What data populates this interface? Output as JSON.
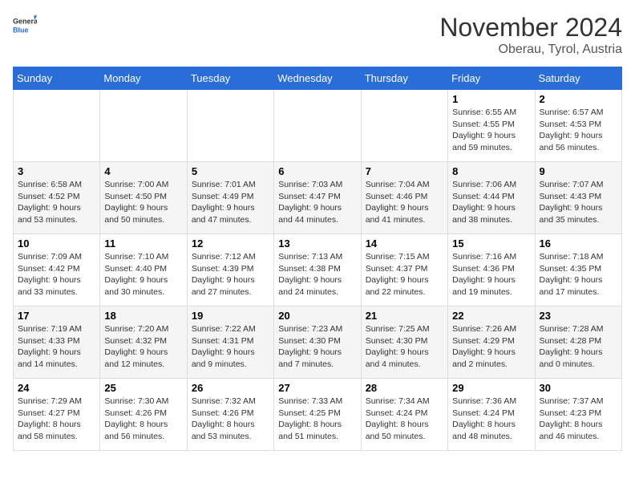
{
  "header": {
    "logo_line1": "General",
    "logo_line2": "Blue",
    "month": "November 2024",
    "location": "Oberau, Tyrol, Austria"
  },
  "days_of_week": [
    "Sunday",
    "Monday",
    "Tuesday",
    "Wednesday",
    "Thursday",
    "Friday",
    "Saturday"
  ],
  "weeks": [
    [
      {
        "day": "",
        "info": ""
      },
      {
        "day": "",
        "info": ""
      },
      {
        "day": "",
        "info": ""
      },
      {
        "day": "",
        "info": ""
      },
      {
        "day": "",
        "info": ""
      },
      {
        "day": "1",
        "info": "Sunrise: 6:55 AM\nSunset: 4:55 PM\nDaylight: 9 hours and 59 minutes."
      },
      {
        "day": "2",
        "info": "Sunrise: 6:57 AM\nSunset: 4:53 PM\nDaylight: 9 hours and 56 minutes."
      }
    ],
    [
      {
        "day": "3",
        "info": "Sunrise: 6:58 AM\nSunset: 4:52 PM\nDaylight: 9 hours and 53 minutes."
      },
      {
        "day": "4",
        "info": "Sunrise: 7:00 AM\nSunset: 4:50 PM\nDaylight: 9 hours and 50 minutes."
      },
      {
        "day": "5",
        "info": "Sunrise: 7:01 AM\nSunset: 4:49 PM\nDaylight: 9 hours and 47 minutes."
      },
      {
        "day": "6",
        "info": "Sunrise: 7:03 AM\nSunset: 4:47 PM\nDaylight: 9 hours and 44 minutes."
      },
      {
        "day": "7",
        "info": "Sunrise: 7:04 AM\nSunset: 4:46 PM\nDaylight: 9 hours and 41 minutes."
      },
      {
        "day": "8",
        "info": "Sunrise: 7:06 AM\nSunset: 4:44 PM\nDaylight: 9 hours and 38 minutes."
      },
      {
        "day": "9",
        "info": "Sunrise: 7:07 AM\nSunset: 4:43 PM\nDaylight: 9 hours and 35 minutes."
      }
    ],
    [
      {
        "day": "10",
        "info": "Sunrise: 7:09 AM\nSunset: 4:42 PM\nDaylight: 9 hours and 33 minutes."
      },
      {
        "day": "11",
        "info": "Sunrise: 7:10 AM\nSunset: 4:40 PM\nDaylight: 9 hours and 30 minutes."
      },
      {
        "day": "12",
        "info": "Sunrise: 7:12 AM\nSunset: 4:39 PM\nDaylight: 9 hours and 27 minutes."
      },
      {
        "day": "13",
        "info": "Sunrise: 7:13 AM\nSunset: 4:38 PM\nDaylight: 9 hours and 24 minutes."
      },
      {
        "day": "14",
        "info": "Sunrise: 7:15 AM\nSunset: 4:37 PM\nDaylight: 9 hours and 22 minutes."
      },
      {
        "day": "15",
        "info": "Sunrise: 7:16 AM\nSunset: 4:36 PM\nDaylight: 9 hours and 19 minutes."
      },
      {
        "day": "16",
        "info": "Sunrise: 7:18 AM\nSunset: 4:35 PM\nDaylight: 9 hours and 17 minutes."
      }
    ],
    [
      {
        "day": "17",
        "info": "Sunrise: 7:19 AM\nSunset: 4:33 PM\nDaylight: 9 hours and 14 minutes."
      },
      {
        "day": "18",
        "info": "Sunrise: 7:20 AM\nSunset: 4:32 PM\nDaylight: 9 hours and 12 minutes."
      },
      {
        "day": "19",
        "info": "Sunrise: 7:22 AM\nSunset: 4:31 PM\nDaylight: 9 hours and 9 minutes."
      },
      {
        "day": "20",
        "info": "Sunrise: 7:23 AM\nSunset: 4:30 PM\nDaylight: 9 hours and 7 minutes."
      },
      {
        "day": "21",
        "info": "Sunrise: 7:25 AM\nSunset: 4:30 PM\nDaylight: 9 hours and 4 minutes."
      },
      {
        "day": "22",
        "info": "Sunrise: 7:26 AM\nSunset: 4:29 PM\nDaylight: 9 hours and 2 minutes."
      },
      {
        "day": "23",
        "info": "Sunrise: 7:28 AM\nSunset: 4:28 PM\nDaylight: 9 hours and 0 minutes."
      }
    ],
    [
      {
        "day": "24",
        "info": "Sunrise: 7:29 AM\nSunset: 4:27 PM\nDaylight: 8 hours and 58 minutes."
      },
      {
        "day": "25",
        "info": "Sunrise: 7:30 AM\nSunset: 4:26 PM\nDaylight: 8 hours and 56 minutes."
      },
      {
        "day": "26",
        "info": "Sunrise: 7:32 AM\nSunset: 4:26 PM\nDaylight: 8 hours and 53 minutes."
      },
      {
        "day": "27",
        "info": "Sunrise: 7:33 AM\nSunset: 4:25 PM\nDaylight: 8 hours and 51 minutes."
      },
      {
        "day": "28",
        "info": "Sunrise: 7:34 AM\nSunset: 4:24 PM\nDaylight: 8 hours and 50 minutes."
      },
      {
        "day": "29",
        "info": "Sunrise: 7:36 AM\nSunset: 4:24 PM\nDaylight: 8 hours and 48 minutes."
      },
      {
        "day": "30",
        "info": "Sunrise: 7:37 AM\nSunset: 4:23 PM\nDaylight: 8 hours and 46 minutes."
      }
    ]
  ]
}
